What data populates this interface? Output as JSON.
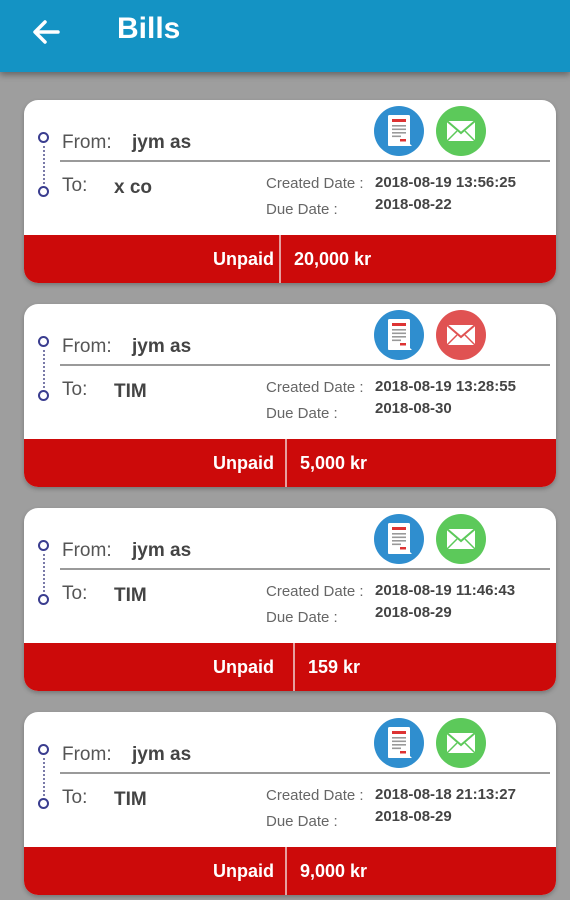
{
  "appbar": {
    "title": "Bills",
    "back_icon": "arrow-left-icon",
    "background": "#1493c4"
  },
  "labels": {
    "from": "From:",
    "to": "To:",
    "created_date": "Created Date :",
    "due_date": "Due Date :"
  },
  "colors": {
    "unpaid_bar": "#cc0a0a",
    "mail_sent": "#5cc95a",
    "mail_unsent": "#e05252",
    "doc_icon": "#2f8ecf"
  },
  "bills": [
    {
      "from": "jym as",
      "to": "x co",
      "created": "2018-08-19 13:56:25",
      "due": "2018-08-22",
      "status": "Unpaid",
      "amount": "20,000 kr",
      "mail_state": "sent"
    },
    {
      "from": "jym as",
      "to": "TIM",
      "created": "2018-08-19 13:28:55",
      "due": "2018-08-30",
      "status": "Unpaid",
      "amount": "5,000 kr",
      "mail_state": "unsent"
    },
    {
      "from": "jym as",
      "to": "TIM",
      "created": "2018-08-19 11:46:43",
      "due": "2018-08-29",
      "status": "Unpaid",
      "amount": "159 kr",
      "mail_state": "sent"
    },
    {
      "from": "jym as",
      "to": "TIM",
      "created": "2018-08-18 21:13:27",
      "due": "2018-08-29",
      "status": "Unpaid",
      "amount": "9,000 kr",
      "mail_state": "sent"
    }
  ]
}
